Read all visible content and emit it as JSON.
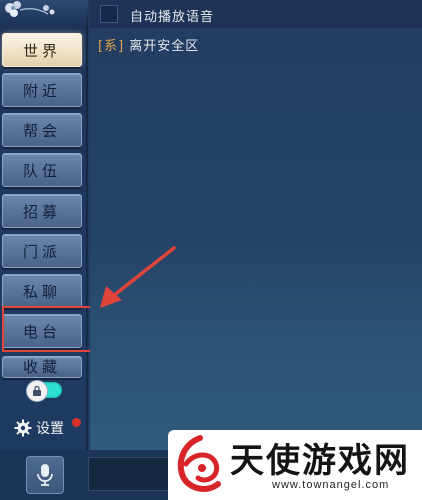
{
  "sidebar": {
    "tabs": [
      {
        "label": "世界",
        "active": true
      },
      {
        "label": "附近",
        "active": false
      },
      {
        "label": "帮会",
        "active": false
      },
      {
        "label": "队伍",
        "active": false
      },
      {
        "label": "招募",
        "active": false
      },
      {
        "label": "门派",
        "active": false
      },
      {
        "label": "私聊",
        "active": false
      },
      {
        "label": "电台",
        "active": false
      },
      {
        "label": "收藏",
        "active": false
      }
    ],
    "settings_label": "设置",
    "toggle_on": true
  },
  "chat": {
    "autoplay_voice_label": "自动播放语音",
    "messages": [
      {
        "tag": "[系]",
        "text": "离开安全区"
      }
    ]
  },
  "colors": {
    "highlight": "#e0453a",
    "toggle": "#2ee0d0",
    "message_tag": "#e0a24c"
  },
  "icons": [
    "flower-decoration-icon",
    "lock-icon",
    "gear-icon",
    "microphone-icon",
    "arrow-annotation-icon"
  ],
  "watermark": {
    "text": "天使游戏网",
    "url": "www.townangel.com"
  }
}
